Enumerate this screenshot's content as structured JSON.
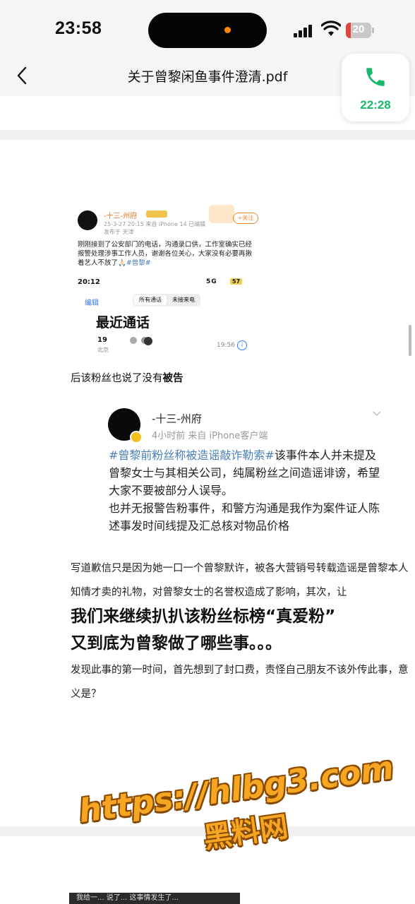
{
  "status_bar": {
    "time": "23:58",
    "battery_level": "20",
    "battery_fraction": 0.2,
    "battery_color": "#e0453e",
    "recording_dot_color": "#ff8a00"
  },
  "nav": {
    "title": "关于曾黎闲鱼事件澄清.pdf"
  },
  "call_pill": {
    "duration": "22:28",
    "color": "#1ab86a"
  },
  "doc": {
    "screenshot1": {
      "username": "-十三-州府",
      "meta": "25-3-27 20:15 来自 iPhone 14 已编辑",
      "location": "发布于 天津",
      "follow_label": "+关注",
      "post_text": "刚刚接到了公安部门的电话，沟通录口供，工作室确实已经报警处理涉事工作人员，谢谢各位关心，大家没有必要再揪着艺人不放了🙏🏻",
      "post_tag": "#曾黎#",
      "phone_time": "20:12",
      "phone_net": "5G",
      "phone_batt": "57",
      "edit_label": "编辑",
      "seg_all": "所有通话",
      "seg_missed": "未接来电",
      "recent_title": "最近通话",
      "caller": "19",
      "caller_location": "北京",
      "call_time": "19:56"
    },
    "caption1_prefix": "后该粉丝也说了没有",
    "caption1_bold": "被告",
    "screenshot2": {
      "username": "-十三-州府",
      "meta": "4小时前  来自 iPhone客户端",
      "tag": "#曾黎前粉丝称被造谣敲诈勒索#",
      "line1": "该事件本人并未提及曾黎女士与其相关公司，纯属粉丝之间造谣诽谤，希望大家不要被部分人误导。",
      "line2": "也并无报警告粉事件，和警方沟通是我作为案件证人陈述事发时间线提及汇总核对物品价格"
    },
    "para2": "写道歉信只是因为她一口一个曾黎默许，被各大营销号转载造谣是曾黎本人知情才卖的礼物，对曾黎女士的名誉权造成了影响，其次，让",
    "headline1": "我们来继续扒扒该粉丝标榜“真爱粉”",
    "headline2": "又到底为曾黎做了哪些事。。。",
    "para3": "发现此事的第一时间，首先想到了封口费，责怪自己朋友不该外传此事，意义是？",
    "bottom_strip": "我给一... 说了... 这事情发生了..."
  },
  "watermark": {
    "url": "https://hlbg3.com",
    "name": "黑料网"
  }
}
